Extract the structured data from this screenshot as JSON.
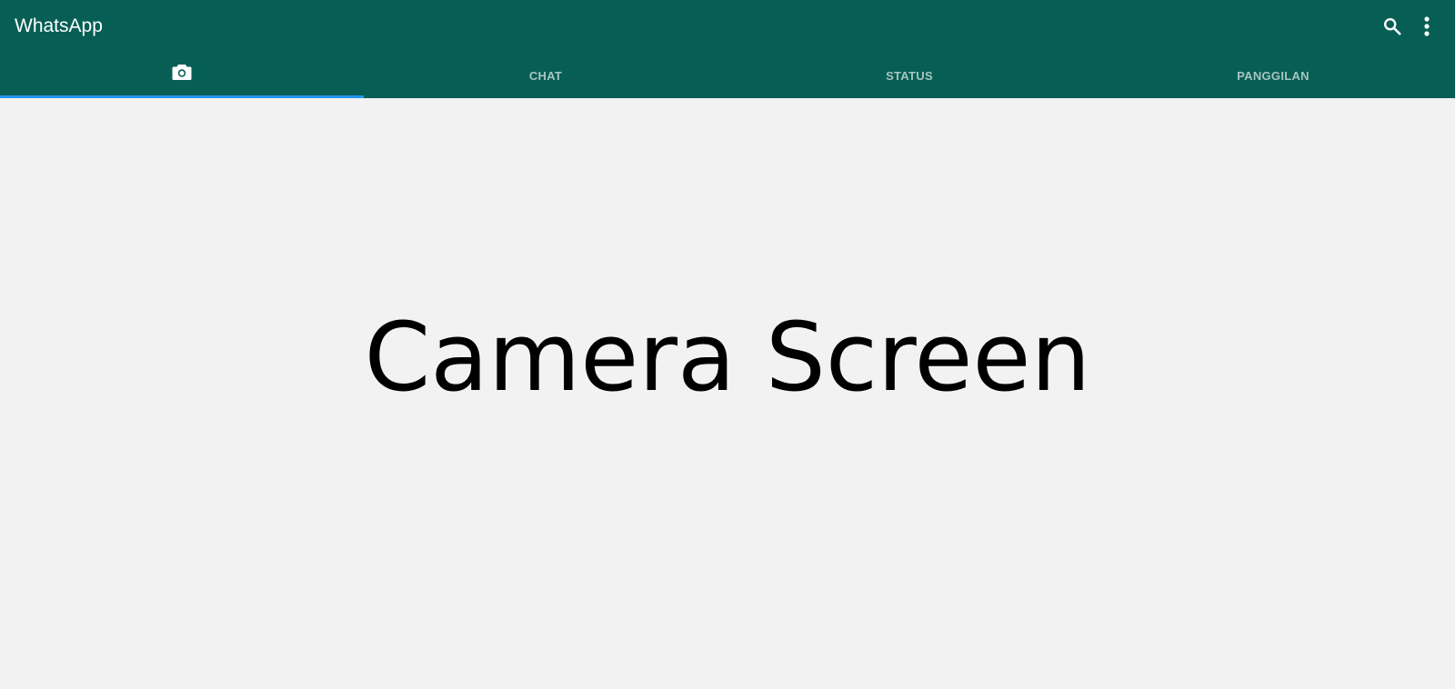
{
  "app": {
    "title": "WhatsApp"
  },
  "toolbar": {
    "icons": [
      "search-icon",
      "more-vert-icon"
    ]
  },
  "tabs": [
    {
      "label": "",
      "icon": "camera-icon",
      "active": true
    },
    {
      "label": "CHAT",
      "active": false
    },
    {
      "label": "STATUS",
      "active": false
    },
    {
      "label": "PANGGILAN",
      "active": false
    }
  ],
  "main": {
    "label": "Camera Screen"
  },
  "colors": {
    "appbar": "#075e54",
    "indicator": "#2196f3",
    "inactive_tab_text": "#a7c5c1",
    "background": "#f2f2f2"
  }
}
